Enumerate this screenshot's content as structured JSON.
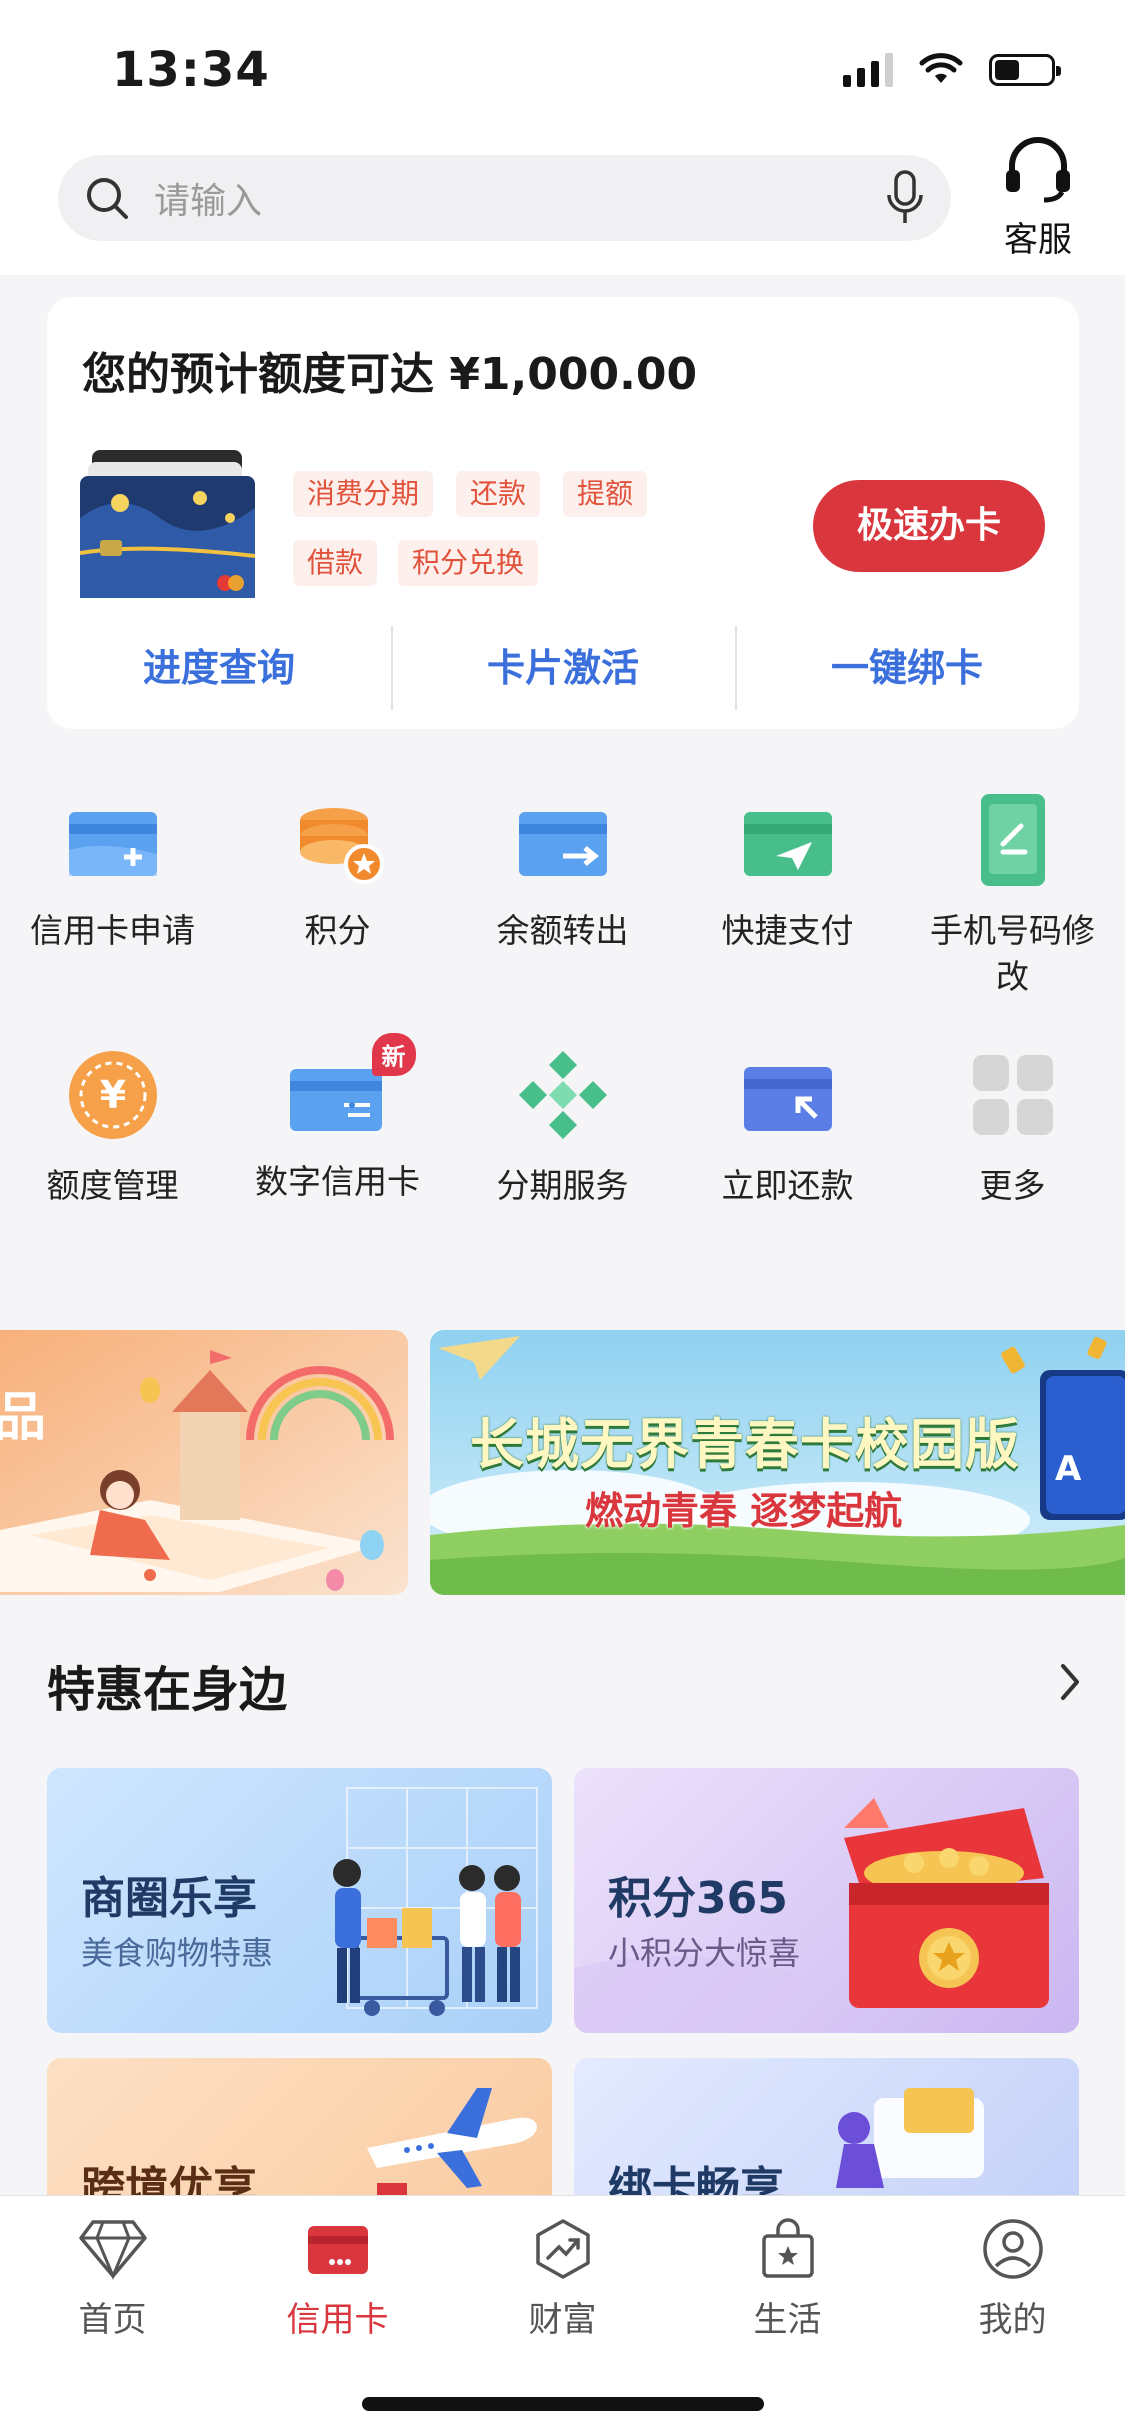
{
  "status_bar": {
    "time": "13:34",
    "battery_level": 0.45
  },
  "search": {
    "placeholder": "请输入"
  },
  "customer_service": {
    "label": "客服"
  },
  "card_block": {
    "title": "您的预计额度可达 ¥1,000.00",
    "tags": [
      "消费分期",
      "还款",
      "提额",
      "借款",
      "积分兑换"
    ],
    "apply_label": "极速办卡",
    "links": [
      "进度查询",
      "卡片激活",
      "一键绑卡"
    ]
  },
  "services": [
    {
      "label": "信用卡申请",
      "icon": "card-plus-icon"
    },
    {
      "label": "积分",
      "icon": "points-coin-icon"
    },
    {
      "label": "余额转出",
      "icon": "card-transfer-icon"
    },
    {
      "label": "快捷支付",
      "icon": "paper-plane-card-icon"
    },
    {
      "label": "手机号码修改",
      "icon": "phone-edit-icon"
    },
    {
      "label": "额度管理",
      "icon": "yen-limit-icon"
    },
    {
      "label": "数字信用卡",
      "icon": "digital-card-icon",
      "badge": "新"
    },
    {
      "label": "分期服务",
      "icon": "diamond-grid-icon"
    },
    {
      "label": "立即还款",
      "icon": "card-repay-icon"
    },
    {
      "label": "更多",
      "icon": "more-grid-icon"
    }
  ],
  "banner": {
    "title": "长城无界青春卡校园版",
    "subtitle": "燃动青春 逐梦起航"
  },
  "section": {
    "title": "特惠在身边"
  },
  "promos": [
    {
      "title": "商圈乐享",
      "subtitle": "美食购物特惠"
    },
    {
      "title": "积分365",
      "subtitle": "小积分大惊喜"
    },
    {
      "title": "跨境优享",
      "subtitle": ""
    },
    {
      "title": "绑卡畅享",
      "subtitle": ""
    }
  ],
  "tabbar": [
    {
      "label": "首页",
      "icon": "diamond-icon"
    },
    {
      "label": "信用卡",
      "icon": "credit-card-icon",
      "active": true
    },
    {
      "label": "财富",
      "icon": "wealth-trend-icon"
    },
    {
      "label": "生活",
      "icon": "shopping-bag-icon"
    },
    {
      "label": "我的",
      "icon": "profile-icon"
    }
  ],
  "colors": {
    "accent": "#d9363e",
    "link_blue": "#3a6fdc",
    "tag_orange": "#e0523b"
  }
}
